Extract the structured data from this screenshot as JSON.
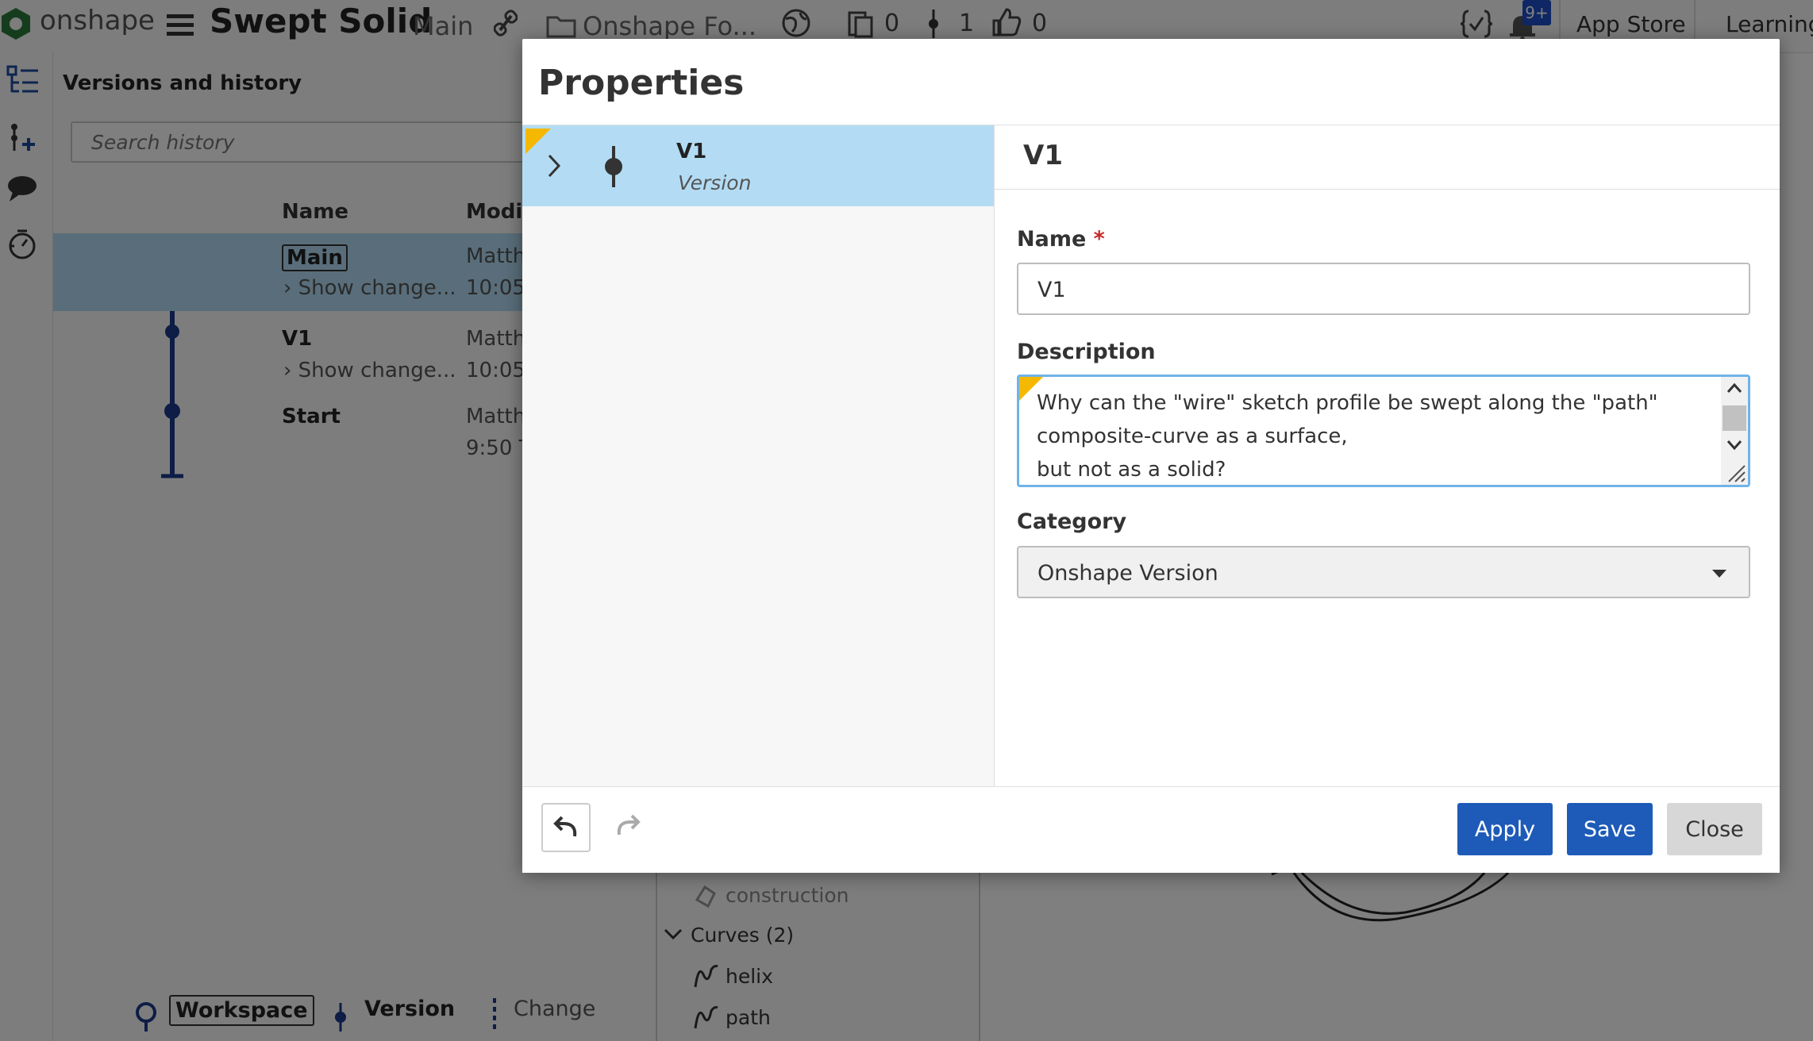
{
  "topbar": {
    "logo_text": "onshape",
    "document_title": "Swept Solid",
    "workspace": "Main",
    "folder": "Onshape Fo...",
    "count_docs": "0",
    "count_versions": "1",
    "count_likes": "0",
    "notif_badge": "9+",
    "app_store": "App Store",
    "learning": "Learning"
  },
  "history": {
    "title": "Versions and history",
    "search_placeholder": "Search history",
    "col_name": "Name",
    "col_modified": "Modifi",
    "rows": [
      {
        "name": "Main",
        "sub": "Show change...",
        "mod1": "Matth",
        "mod2": "10:05"
      },
      {
        "name": "V1",
        "sub": "Show change...",
        "mod1": "Matth",
        "mod2": "10:05"
      },
      {
        "name": "Start",
        "sub": "",
        "mod1": "Matth",
        "mod2": "9:50 T"
      }
    ]
  },
  "tree": {
    "items": [
      {
        "label": "construction"
      },
      {
        "label": "Curves (2)"
      },
      {
        "label": "helix"
      },
      {
        "label": "path"
      }
    ]
  },
  "legend": {
    "workspace": "Workspace",
    "version": "Version",
    "change": "Change"
  },
  "dialog": {
    "title": "Properties",
    "list": {
      "item_name": "V1",
      "item_type": "Version"
    },
    "panel_title": "V1",
    "name_label": "Name",
    "required_mark": "*",
    "name_value": "V1",
    "description_label": "Description",
    "description_value": "Why can the \"wire\" sketch profile be swept along the \"path\" composite-curve as a surface,\nbut not as a solid?",
    "category_label": "Category",
    "category_value": "Onshape Version",
    "apply": "Apply",
    "save": "Save",
    "close": "Close"
  },
  "colors": {
    "accent": "#1e5bb8",
    "selection": "#b3dcf4",
    "warning_flag": "#f5b800",
    "history_line": "#1a3a8c"
  }
}
